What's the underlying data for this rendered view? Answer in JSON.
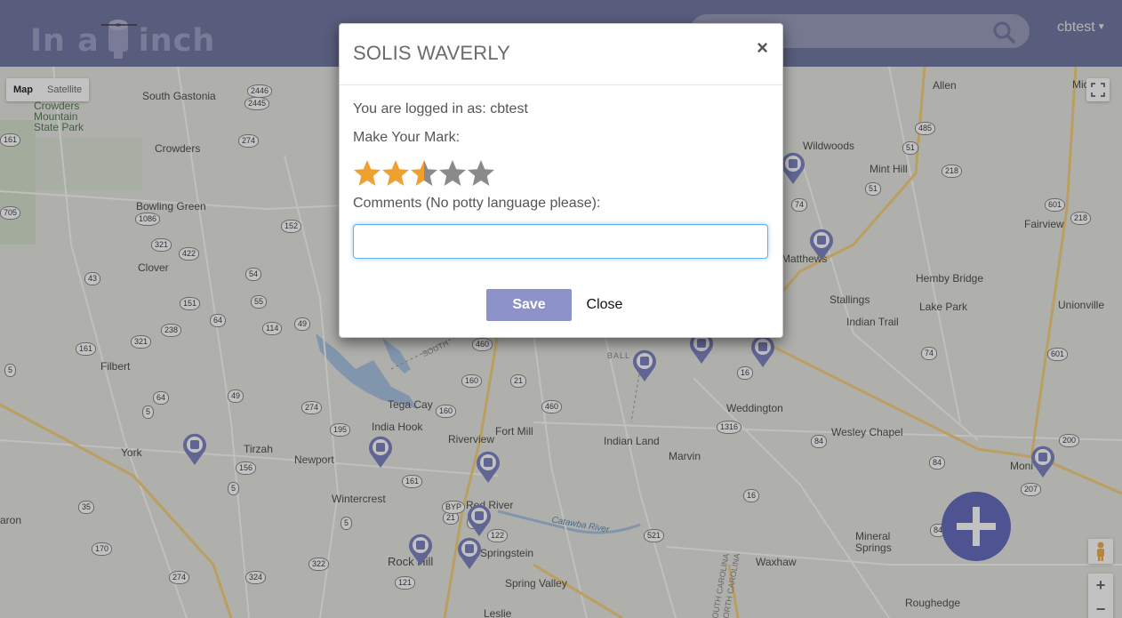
{
  "app": {
    "logo_text_left": "In a",
    "logo_text_right": "inch",
    "user_menu_label": "cbtest",
    "search_placeholder": ""
  },
  "map": {
    "type_controls": [
      "Map",
      "Satellite"
    ],
    "active_type": "Map",
    "place_labels": [
      {
        "name": "South Gastonia",
        "id": "south-gastonia"
      },
      {
        "name": "Crowders Mountain State Park",
        "id": "crowders-park"
      },
      {
        "name": "Crowders",
        "id": "crowders"
      },
      {
        "name": "Bowling Green",
        "id": "bowling-green"
      },
      {
        "name": "Clover",
        "id": "clover"
      },
      {
        "name": "Filbert",
        "id": "filbert"
      },
      {
        "name": "York",
        "id": "york"
      },
      {
        "name": "Tirzah",
        "id": "tirzah"
      },
      {
        "name": "Newport",
        "id": "newport"
      },
      {
        "name": "Tega Cay",
        "id": "tega-cay"
      },
      {
        "name": "India Hook",
        "id": "india-hook"
      },
      {
        "name": "Riverview",
        "id": "riverview"
      },
      {
        "name": "Fort Mill",
        "id": "fort-mill"
      },
      {
        "name": "Wintercrest",
        "id": "wintercrest"
      },
      {
        "name": "Red River",
        "id": "red-river"
      },
      {
        "name": "Rock Hill",
        "id": "rock-hill"
      },
      {
        "name": "Springstein",
        "id": "springstein"
      },
      {
        "name": "Spring Valley",
        "id": "spring-valley"
      },
      {
        "name": "Leslie",
        "id": "leslie"
      },
      {
        "name": "Indian Land",
        "id": "indian-land"
      },
      {
        "name": "Marvin",
        "id": "marvin"
      },
      {
        "name": "Weddington",
        "id": "weddington"
      },
      {
        "name": "Wesley Chapel",
        "id": "wesley-chapel"
      },
      {
        "name": "Waxhaw",
        "id": "waxhaw"
      },
      {
        "name": "Mineral Springs",
        "id": "mineral-springs"
      },
      {
        "name": "Roughedge",
        "id": "roughedge"
      },
      {
        "name": "Allen",
        "id": "allen"
      },
      {
        "name": "Wildwoods",
        "id": "wildwoods"
      },
      {
        "name": "Mint Hill",
        "id": "mint-hill"
      },
      {
        "name": "Matthews",
        "id": "matthews"
      },
      {
        "name": "Stallings",
        "id": "stallings"
      },
      {
        "name": "Indian Trail",
        "id": "indian-trail"
      },
      {
        "name": "Hemby Bridge",
        "id": "hemby-bridge"
      },
      {
        "name": "Lake Park",
        "id": "lake-park"
      },
      {
        "name": "Fairview",
        "id": "fairview"
      },
      {
        "name": "Unionville",
        "id": "unionville"
      },
      {
        "name": "Catawba River",
        "id": "catawba-river"
      },
      {
        "name": "Mic",
        "id": "mic"
      },
      {
        "name": "Moni",
        "id": "moni"
      },
      {
        "name": "aron",
        "id": "aron"
      },
      {
        "name": "BALL",
        "id": "ball"
      },
      {
        "name": "SOUTH",
        "id": "south"
      },
      {
        "name": "SOUTH CAROLINA",
        "id": "sc-1"
      },
      {
        "name": "NORTH CAROLINA",
        "id": "nc-1"
      }
    ],
    "shields": [
      "2446",
      "2445",
      "274",
      "161",
      "705",
      "1086",
      "321",
      "422",
      "152",
      "43",
      "151",
      "54",
      "64",
      "55",
      "114",
      "49",
      "238",
      "321",
      "161",
      "5",
      "64",
      "49",
      "274",
      "5",
      "195",
      "156",
      "5",
      "35",
      "161",
      "160",
      "21",
      "460",
      "160",
      "460",
      "16",
      "1316",
      "84",
      "84",
      "16",
      "521",
      "170",
      "322",
      "121",
      "324",
      "274",
      "5",
      "84",
      "218",
      "51",
      "74",
      "74",
      "601",
      "218",
      "51",
      "485",
      "601",
      "200",
      "207",
      "21",
      "122",
      "BYP",
      "5"
    ],
    "zoom_in": "+",
    "zoom_out": "−"
  },
  "modal": {
    "title": "SOLIS WAVERLY",
    "close_symbol": "×",
    "logged_in_text": "You are logged in as: cbtest",
    "rating_label": "Make Your Mark:",
    "rating": 2.5,
    "rating_max": 5,
    "comments_label": "Comments (No potty language please):",
    "comments_value": "",
    "save_label": "Save",
    "close_label": "Close"
  },
  "colors": {
    "header": "#5f6496",
    "star_filled": "#f0a030",
    "star_empty": "#8a8a8a",
    "save_button": "#8d92c9",
    "fab": "#4d55b4"
  }
}
